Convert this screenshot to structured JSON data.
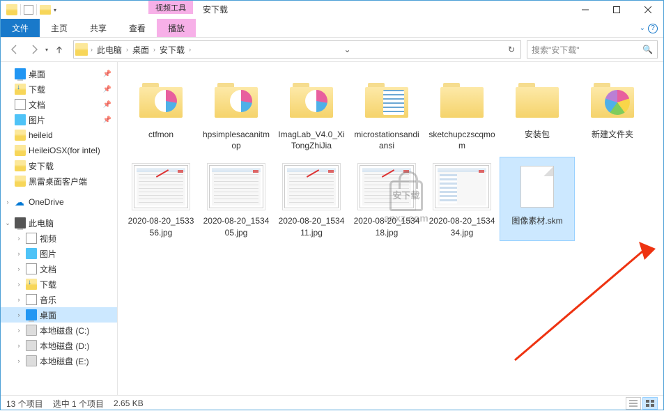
{
  "title_bar": {
    "context_tab": "视频工具",
    "window_title": "安下载"
  },
  "ribbon": {
    "file": "文件",
    "tabs": [
      "主页",
      "共享",
      "查看"
    ],
    "context_tab": "播放"
  },
  "nav": {
    "breadcrumb": [
      "此电脑",
      "桌面",
      "安下载"
    ],
    "search_placeholder": "搜索\"安下载\""
  },
  "tree": {
    "quick": [
      {
        "label": "桌面",
        "icon": "desktop",
        "pin": true
      },
      {
        "label": "下载",
        "icon": "download",
        "pin": true
      },
      {
        "label": "文档",
        "icon": "doc",
        "pin": true
      },
      {
        "label": "图片",
        "icon": "pic",
        "pin": true
      },
      {
        "label": "heileid",
        "icon": "folder"
      },
      {
        "label": "HeileiOSX(for intel)",
        "icon": "folder"
      },
      {
        "label": "安下载",
        "icon": "folder"
      },
      {
        "label": "黑雷桌面客户端",
        "icon": "folder"
      }
    ],
    "onedrive": "OneDrive",
    "this_pc": "此电脑",
    "pc_items": [
      {
        "label": "视频",
        "icon": "video"
      },
      {
        "label": "图片",
        "icon": "pic"
      },
      {
        "label": "文档",
        "icon": "doc"
      },
      {
        "label": "下载",
        "icon": "download"
      },
      {
        "label": "音乐",
        "icon": "music"
      },
      {
        "label": "桌面",
        "icon": "desktop",
        "selected": true
      },
      {
        "label": "本地磁盘 (C:)",
        "icon": "drive"
      },
      {
        "label": "本地磁盘 (D:)",
        "icon": "drive"
      },
      {
        "label": "本地磁盘 (E:)",
        "icon": "drive"
      }
    ]
  },
  "items": {
    "folders": [
      {
        "name": "ctfmon",
        "preview": "circ"
      },
      {
        "name": "hpsimplesacanitmop",
        "preview": "circ"
      },
      {
        "name": "ImagLab_V4.0_XiTongZhiJia",
        "preview": "circ"
      },
      {
        "name": "microstationsandiansi",
        "preview": "bars"
      },
      {
        "name": "sketchupczscqmom",
        "preview": ""
      },
      {
        "name": "安装包",
        "preview": ""
      },
      {
        "name": "新建文件夹",
        "preview": "pinwheel"
      }
    ],
    "images": [
      {
        "name": "2020-08-20_153356.jpg",
        "style": "arrow"
      },
      {
        "name": "2020-08-20_153405.jpg",
        "style": "lines"
      },
      {
        "name": "2020-08-20_153411.jpg",
        "style": "arrow"
      },
      {
        "name": "2020-08-20_153418.jpg",
        "style": "arrow"
      },
      {
        "name": "2020-08-20_153434.jpg",
        "style": "list"
      }
    ],
    "selected_file": "图像素材.skm"
  },
  "watermark": {
    "text": "安下载",
    "url": "anxz.com"
  },
  "status": {
    "count": "13 个项目",
    "selection": "选中 1 个项目",
    "size": "2.65 KB"
  }
}
